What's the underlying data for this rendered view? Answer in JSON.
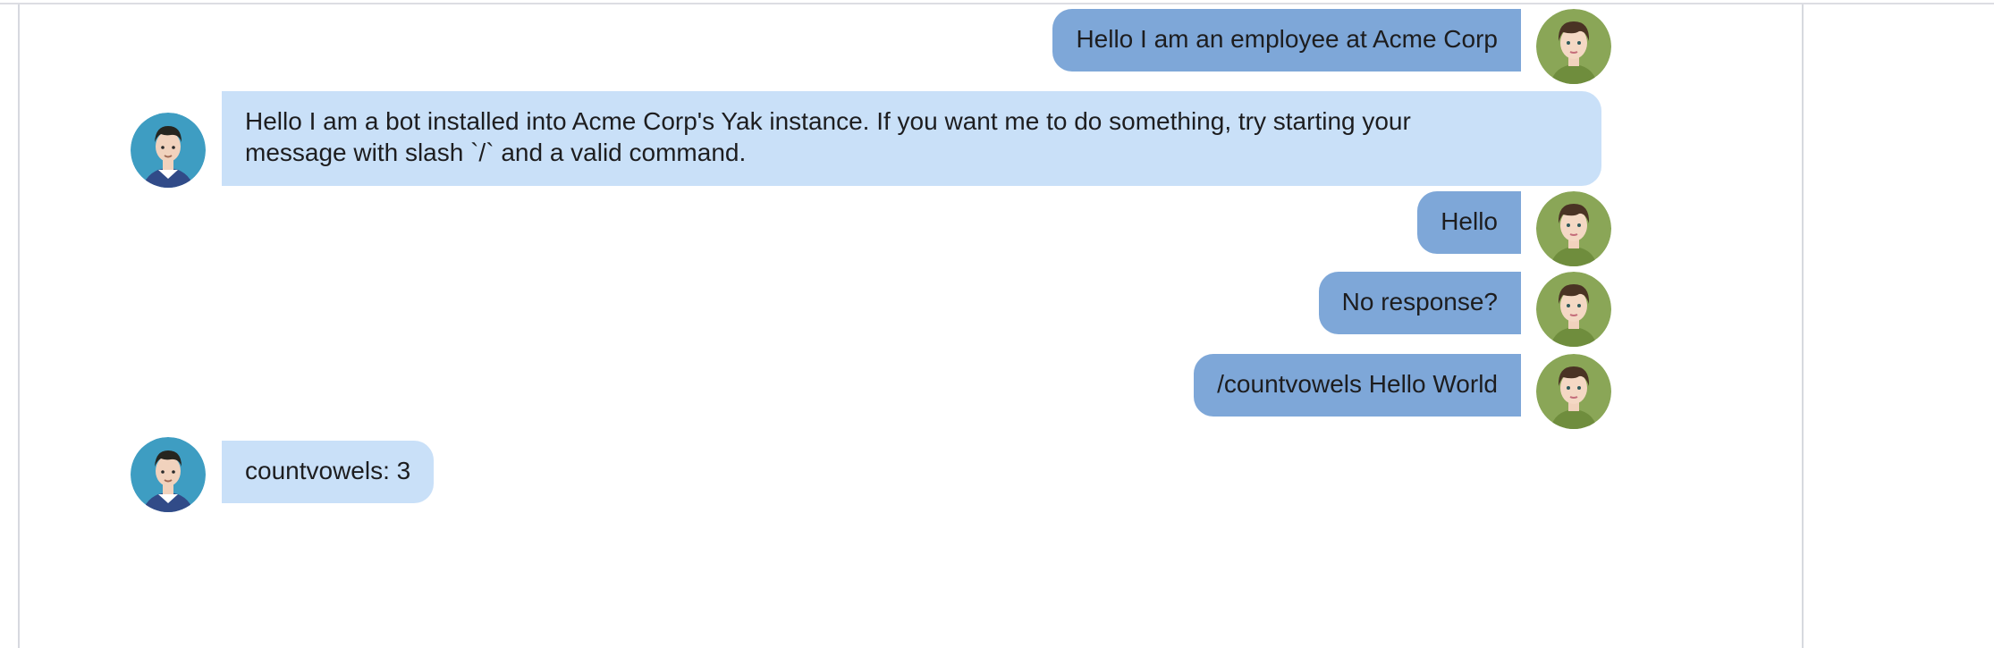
{
  "conversation": {
    "messages": [
      {
        "sender": "user",
        "text": "Hello I am an employee at Acme Corp"
      },
      {
        "sender": "bot",
        "text_lines": [
          "Hello I am a bot installed into Acme Corp's Yak instance. If you want me to do something, try starting your",
          "message with slash `/` and a valid command."
        ]
      },
      {
        "sender": "user",
        "text": "Hello"
      },
      {
        "sender": "user",
        "text": "No response?"
      },
      {
        "sender": "user",
        "text": "/countvowels Hello World"
      },
      {
        "sender": "bot",
        "text": "countvowels: 3"
      }
    ]
  },
  "icons": {
    "user_avatar": "female-avatar-icon",
    "bot_avatar": "male-avatar-icon"
  },
  "colors": {
    "outgoing_bubble": "#7ea7d8",
    "incoming_bubble": "#c9e0f8",
    "user_avatar_bg": "#8aa657",
    "bot_avatar_bg": "#3e9dc2"
  }
}
